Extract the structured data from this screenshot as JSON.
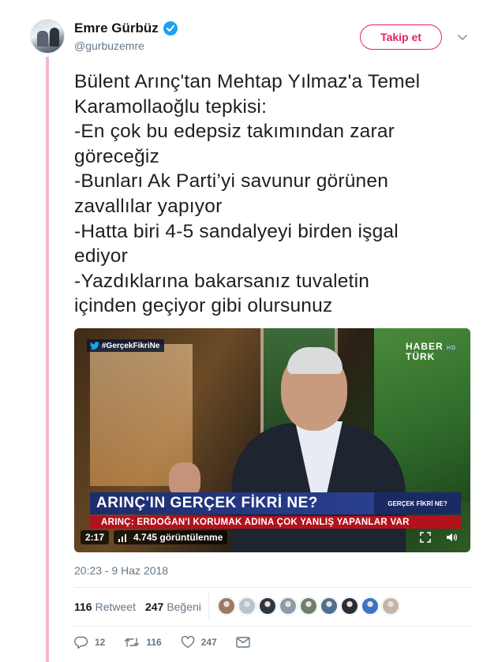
{
  "user": {
    "display_name": "Emre Gürbüz",
    "handle": "@gurbuzemre",
    "verified": true,
    "avatar_icon": "profile-photo"
  },
  "follow_button": {
    "label": "Takip et"
  },
  "tweet": {
    "text": "Bülent Arınç'tan Mehtap Yılmaz'a Temel\nKaramollaoğlu tepkisi:\n-En çok bu edepsiz takımından zarar\ngöreceğiz\n-Bunları Ak Parti’yi savunur görünen\nzavallılar yapıyor\n-Hatta biri 4-5 sandalyeyi birden işgal\nediyor\n-Yazdıklarına bakarsanız  tuvaletin\niçinden geçiyor gibi olursunuz"
  },
  "media": {
    "hashtag": "#GerçekFikriNe",
    "channel_line1": "HABER",
    "channel_hd": "HD",
    "channel_line2": "TÜRK",
    "headline": "ARINÇ'IN GERÇEK FİKRİ NE?",
    "side_label": "GERÇEK FİKRİ NE?",
    "subheadline": "ARINÇ: ERDOĞAN'I KORUMAK ADINA ÇOK YANLIŞ YAPANLAR VAR",
    "duration": "2:17",
    "views": "4.745 görüntülenme"
  },
  "timestamp": "20:23 - 9 Haz 2018",
  "stats": {
    "retweets_count": "116",
    "retweets_label": "Retweet",
    "likes_count": "247",
    "likes_label": "Beğeni"
  },
  "likers": [
    "#9c7a63",
    "#b9c3cc",
    "#2f3640",
    "#8e9aa6",
    "#6f7f6a",
    "#4f6f8f",
    "#2b2f35",
    "#3a73c8",
    "#c6b4a8"
  ],
  "actions": {
    "reply_count": "12",
    "retweet_count": "116",
    "like_count": "247"
  },
  "colors": {
    "accent": "#e0245e",
    "thread_line": "#f3b7d8",
    "verified": "#1da1f2",
    "muted": "#657786"
  }
}
